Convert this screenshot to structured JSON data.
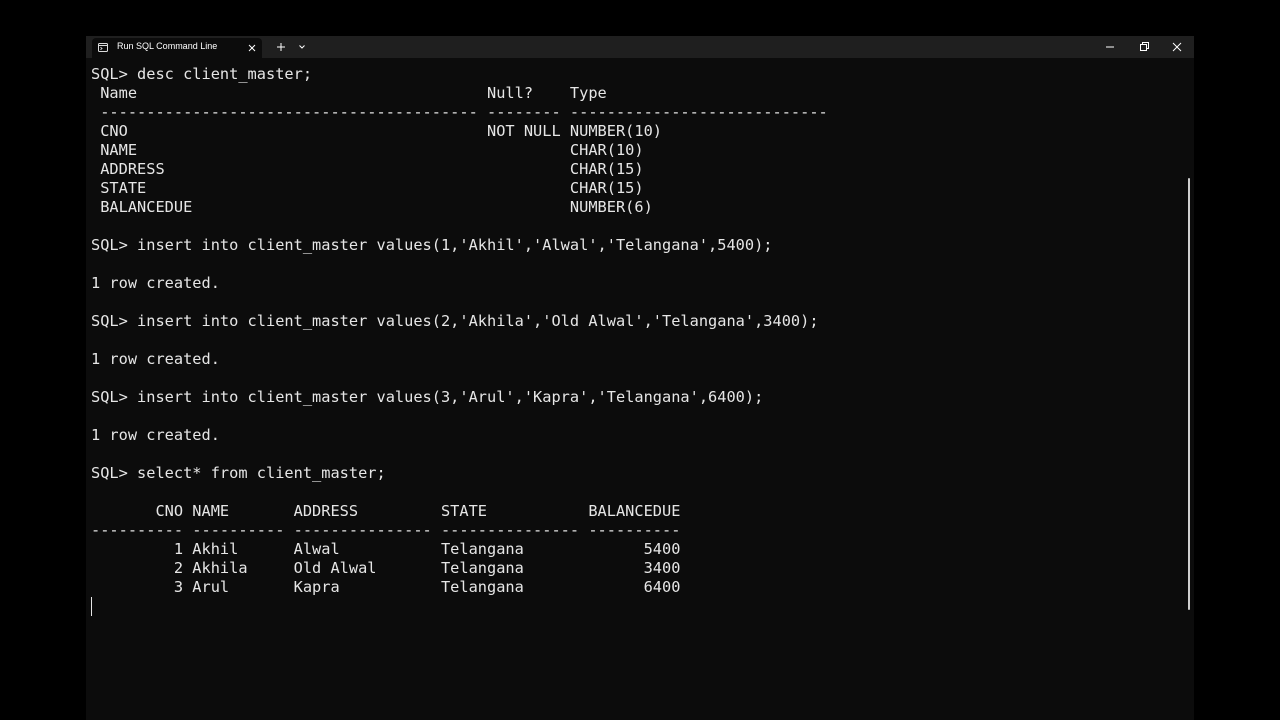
{
  "window": {
    "tab_title": "Run SQL Command Line",
    "tab_icon": "terminal-icon",
    "new_tab_icon": "plus-icon",
    "dropdown_icon": "chevron-down-icon",
    "minimize_icon": "minimize-icon",
    "maximize_icon": "restore-icon",
    "close_icon": "close-icon"
  },
  "terminal": {
    "colors": {
      "background": "#0c0c0c",
      "foreground": "#e6e6e6",
      "titlebar": "#1f1f1f"
    },
    "lines": [
      "SQL> desc client_master;",
      " Name                                      Null?    Type",
      " ----------------------------------------- -------- ----------------------------",
      " CNO                                       NOT NULL NUMBER(10)",
      " NAME                                               CHAR(10)",
      " ADDRESS                                            CHAR(15)",
      " STATE                                              CHAR(15)",
      " BALANCEDUE                                         NUMBER(6)",
      "",
      "SQL> insert into client_master values(1,'Akhil','Alwal','Telangana',5400);",
      "",
      "1 row created.",
      "",
      "SQL> insert into client_master values(2,'Akhila','Old Alwal','Telangana',3400);",
      "",
      "1 row created.",
      "",
      "SQL> insert into client_master values(3,'Arul','Kapra','Telangana',6400);",
      "",
      "1 row created.",
      "",
      "SQL> select* from client_master;",
      "",
      "       CNO NAME       ADDRESS         STATE           BALANCEDUE",
      "---------- ---------- --------------- --------------- ----------",
      "         1 Akhil      Alwal           Telangana             5400",
      "         2 Akhila     Old Alwal       Telangana             3400",
      "         3 Arul       Kapra           Telangana             6400"
    ]
  }
}
